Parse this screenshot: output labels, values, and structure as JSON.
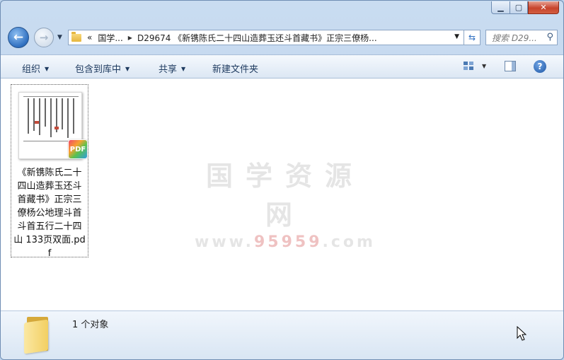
{
  "window": {
    "minimize_icon": "minimize-icon",
    "maximize_icon": "maximize-icon",
    "close_icon": "close-icon"
  },
  "nav": {
    "back_icon": "back-arrow-icon",
    "forward_icon": "forward-arrow-icon"
  },
  "address": {
    "overflow": "«",
    "segment_1": "国学...",
    "segment_2": "D29674 《新镌陈氏二十四山造葬玉还斗首藏书》正宗三僚杨..."
  },
  "search": {
    "placeholder": "搜索 D29..."
  },
  "toolbar": {
    "organize": "组织",
    "include_in_library": "包含到库中",
    "share": "共享",
    "new_folder": "新建文件夹"
  },
  "file": {
    "name": "《新镌陈氏二十四山造葬玉还斗首藏书》正宗三僚杨公地理斗首斗首五行二十四山 133页双面.pdf",
    "badge": "PDF"
  },
  "watermark": {
    "main": "国学资源网",
    "url_prefix": "www.",
    "url_number": "95959",
    "url_suffix": ".com"
  },
  "status": {
    "count": "1 个对象"
  }
}
